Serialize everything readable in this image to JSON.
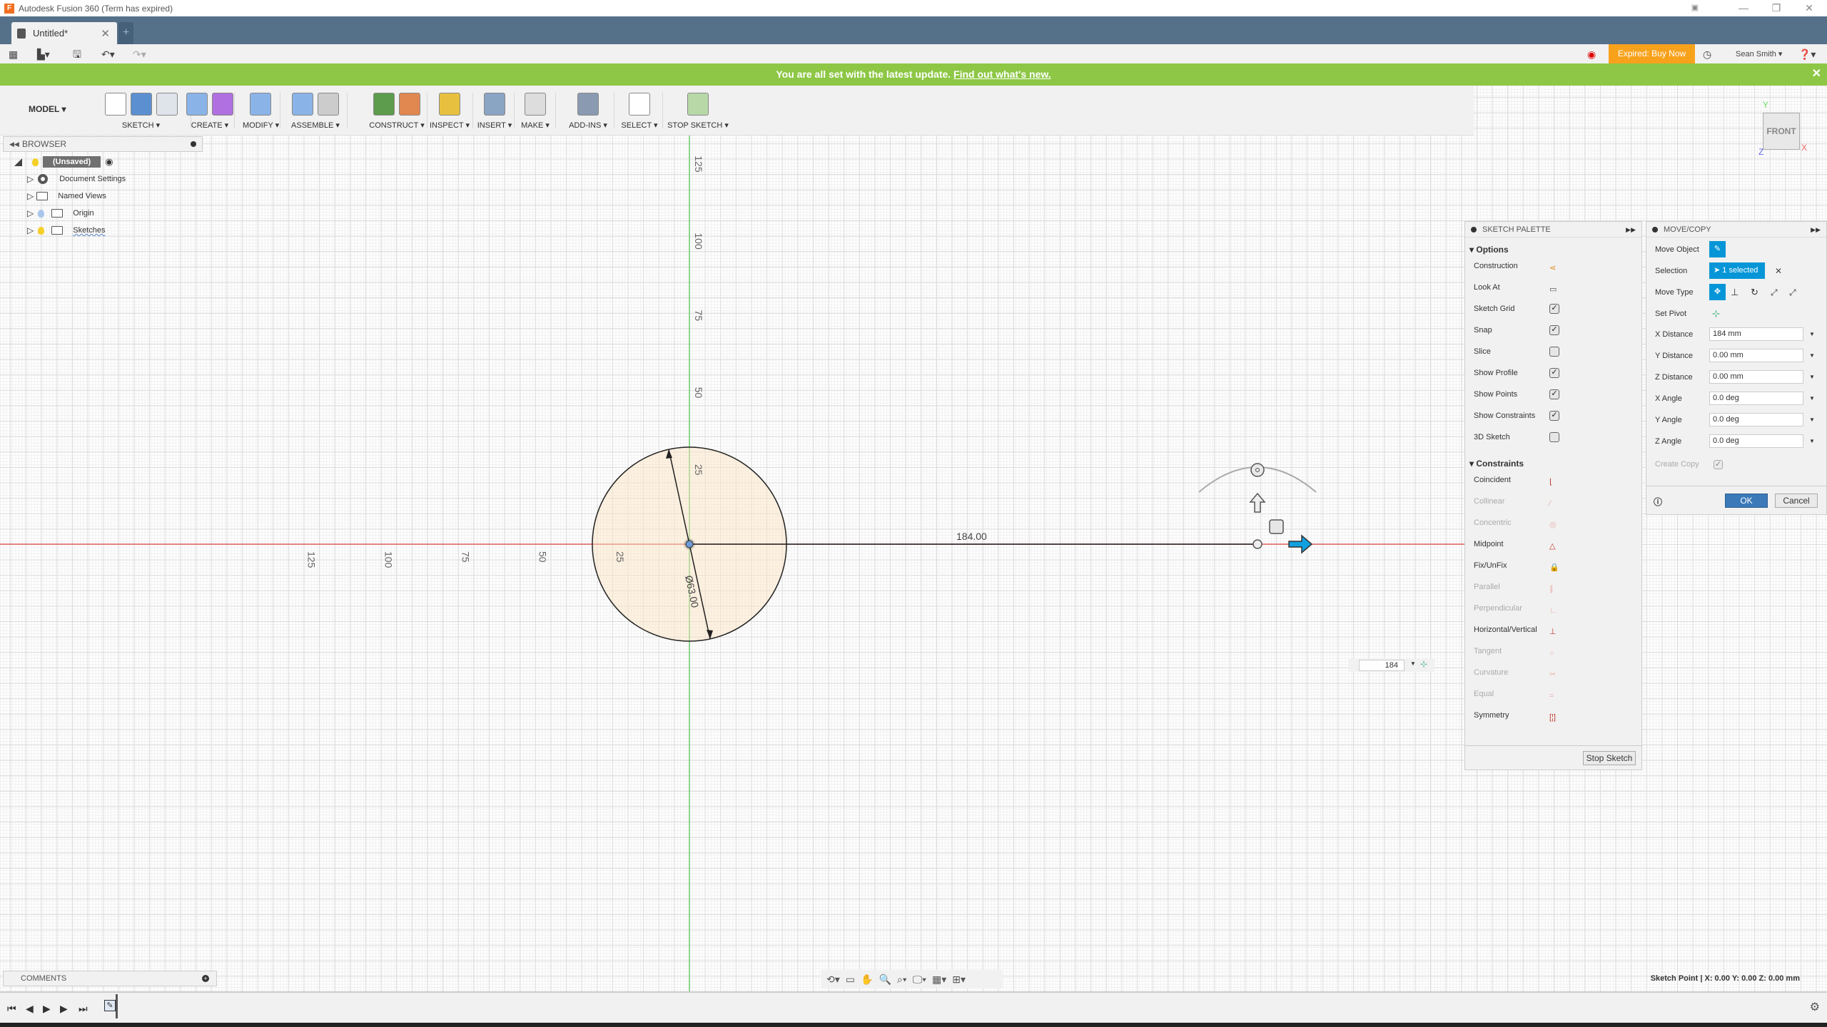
{
  "app": {
    "window_title": "Autodesk Fusion 360 (Term has expired)",
    "document_tab": "Untitled*",
    "new_tab_label": "+"
  },
  "quick_access": {
    "expired_label": "Expired: Buy Now",
    "user_name": "Sean Smith",
    "help_icon": "?"
  },
  "banner": {
    "message": "You are all set with the latest update.",
    "link": "Find out what's new."
  },
  "toolbar": {
    "workspace": "MODEL",
    "groups": [
      "SKETCH",
      "CREATE",
      "MODIFY",
      "ASSEMBLE",
      "CONSTRUCT",
      "INSPECT",
      "INSERT",
      "MAKE",
      "ADD-INS",
      "SELECT",
      "STOP SKETCH"
    ]
  },
  "browser": {
    "title": "BROWSER",
    "root": "(Unsaved)",
    "items": [
      {
        "label": "Document Settings",
        "icon": "gear-icon"
      },
      {
        "label": "Named Views",
        "icon": "folder-icon"
      },
      {
        "label": "Origin",
        "icon": "folder-icon"
      },
      {
        "label": "Sketches",
        "icon": "folder-icon"
      }
    ]
  },
  "canvas": {
    "x_axis_labels": [
      "125",
      "100",
      "75",
      "50",
      "25"
    ],
    "y_axis_labels": [
      "125",
      "100",
      "75",
      "50",
      "25"
    ],
    "diameter_dim": "Ø63.00",
    "distance_dim": "184.00",
    "input_value": "184",
    "view_cube": {
      "face": "FRONT",
      "x": "X",
      "y": "Y",
      "z": "Z"
    }
  },
  "sketch_palette": {
    "title": "SKETCH PALETTE",
    "options_label": "Options",
    "options": [
      {
        "label": "Construction",
        "type": "icon"
      },
      {
        "label": "Look At",
        "type": "icon"
      },
      {
        "label": "Sketch Grid",
        "type": "check",
        "checked": true
      },
      {
        "label": "Snap",
        "type": "check",
        "checked": true
      },
      {
        "label": "Slice",
        "type": "check",
        "checked": false
      },
      {
        "label": "Show Profile",
        "type": "check",
        "checked": true
      },
      {
        "label": "Show Points",
        "type": "check",
        "checked": true
      },
      {
        "label": "Show Constraints",
        "type": "check",
        "checked": true
      },
      {
        "label": "3D Sketch",
        "type": "check",
        "checked": false
      }
    ],
    "constraints_label": "Constraints",
    "constraints": [
      {
        "label": "Coincident",
        "enabled": true
      },
      {
        "label": "Collinear",
        "enabled": false
      },
      {
        "label": "Concentric",
        "enabled": false
      },
      {
        "label": "Midpoint",
        "enabled": true
      },
      {
        "label": "Fix/UnFix",
        "enabled": true
      },
      {
        "label": "Parallel",
        "enabled": false
      },
      {
        "label": "Perpendicular",
        "enabled": false
      },
      {
        "label": "Horizontal/Vertical",
        "enabled": true
      },
      {
        "label": "Tangent",
        "enabled": false
      },
      {
        "label": "Curvature",
        "enabled": false
      },
      {
        "label": "Equal",
        "enabled": false
      },
      {
        "label": "Symmetry",
        "enabled": true
      }
    ],
    "stop_button": "Stop Sketch"
  },
  "move_copy": {
    "title": "MOVE/COPY",
    "move_object_label": "Move Object",
    "selection_label": "Selection",
    "selection_value": "1 selected",
    "move_type_label": "Move Type",
    "set_pivot_label": "Set Pivot",
    "fields": [
      {
        "label": "X Distance",
        "value": "184 mm"
      },
      {
        "label": "Y Distance",
        "value": "0.00 mm"
      },
      {
        "label": "Z Distance",
        "value": "0.00 mm"
      },
      {
        "label": "X Angle",
        "value": "0.0 deg"
      },
      {
        "label": "Y Angle",
        "value": "0.0 deg"
      },
      {
        "label": "Z Angle",
        "value": "0.0 deg"
      }
    ],
    "create_copy_label": "Create Copy",
    "ok": "OK",
    "cancel": "Cancel"
  },
  "comments": {
    "title": "COMMENTS"
  },
  "status": {
    "text": "Sketch Point | X: 0.00 Y: 0.00 Z: 0.00 mm"
  },
  "colors": {
    "accent": "#0696d7",
    "banner": "#8dc745",
    "expired": "#f8a21c",
    "tabbar": "#557089"
  }
}
